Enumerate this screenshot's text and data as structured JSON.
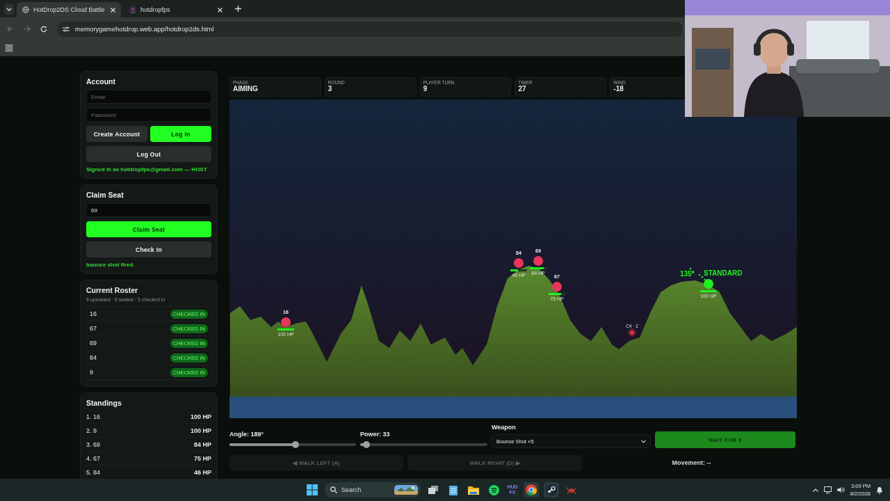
{
  "browser": {
    "tabs": [
      {
        "title": "HotDrop2DS Cloud Battle",
        "selected": true
      },
      {
        "title": "hotdropfps",
        "selected": false
      }
    ],
    "address": "memorygamehotdrop.web.app/hotdrop2ds.html"
  },
  "account": {
    "title": "Account",
    "email_placeholder": "Email",
    "password_placeholder": "Password",
    "buttons": [
      {
        "label": "Create Account",
        "kind": "secondary"
      },
      {
        "label": "Log In",
        "kind": "primary"
      },
      {
        "label": "Log Out",
        "kind": "secondary"
      }
    ],
    "status": "Signed in as hotdropfps@gmail.com — HOST"
  },
  "claim_seat": {
    "title": "Claim Seat",
    "seat_value": "69",
    "buttons": [
      {
        "label": "Claim Seat",
        "kind": "primary"
      },
      {
        "label": "Check In",
        "kind": "secondary"
      }
    ],
    "status": "bounce shot fired."
  },
  "roster": {
    "title": "Current Roster",
    "summary": "5 uploaded · 5 seated · 5 checked in",
    "players": [
      {
        "name": "16",
        "badge": "CHECKED IN",
        "checked_in": true
      },
      {
        "name": "67",
        "badge": "CHECKED IN",
        "checked_in": true
      },
      {
        "name": "69",
        "badge": "CHECKED IN",
        "checked_in": true
      },
      {
        "name": "84",
        "badge": "CHECKED IN",
        "checked_in": true
      },
      {
        "name": "9",
        "badge": "CHECKED IN",
        "checked_in": true
      }
    ]
  },
  "standings": {
    "title": "Standings",
    "rows": [
      {
        "rank": "1. 16",
        "hp": "100 HP"
      },
      {
        "rank": "2. 9",
        "hp": "100 HP"
      },
      {
        "rank": "3. 69",
        "hp": "84 HP"
      },
      {
        "rank": "4. 67",
        "hp": "75 HP"
      },
      {
        "rank": "5. 84",
        "hp": "46 HP"
      }
    ]
  },
  "stats": [
    {
      "label": "PHASE",
      "value": "AIMING"
    },
    {
      "label": "ROUND",
      "value": "3"
    },
    {
      "label": "PLAYER TURN",
      "value": "9"
    },
    {
      "label": "TIMER",
      "value": "27"
    },
    {
      "label": "WIND",
      "value": "-18"
    }
  ],
  "arena": {
    "tanks": [
      {
        "name": "16",
        "hp": "100 HP",
        "level": 1,
        "color": "#e8365a"
      },
      {
        "name": "84",
        "hp": "46 HP",
        "level": 0.46,
        "color": "#e8365a"
      },
      {
        "name": "69",
        "hp": "84 HP",
        "level": 0.84,
        "color": "#e8365a"
      },
      {
        "name": "67",
        "hp": "75 HP",
        "level": 0.75,
        "color": "#e8365a"
      },
      {
        "hp": "100 HP",
        "level": 1,
        "color": "#22ee22"
      }
    ],
    "aim": {
      "angle": "135°",
      "weapon": "STANDARD"
    },
    "mines": [
      {
        "label": "C4 · 2"
      }
    ]
  },
  "controls": {
    "angle": {
      "label": "Angle: 189°",
      "level": 0.52
    },
    "power": {
      "label": "Power: 33",
      "level": 0.05
    },
    "weapon": {
      "label": "Weapon",
      "value": "Bounce Shot ×5"
    },
    "fire_button": {
      "label": "WAIT FOR 9",
      "disabled": true
    },
    "walk_buttons": [
      {
        "label": "◀ WALK LEFT (A)",
        "disabled": true
      },
      {
        "label": "WALK RIGHT (D) ▶",
        "disabled": true
      }
    ],
    "movement": "Movement: --"
  },
  "taskbar": {
    "search_placeholder": "Search",
    "hud_logo": "HUD FX",
    "time": "3:09 PM",
    "date": "8/2/2026"
  }
}
